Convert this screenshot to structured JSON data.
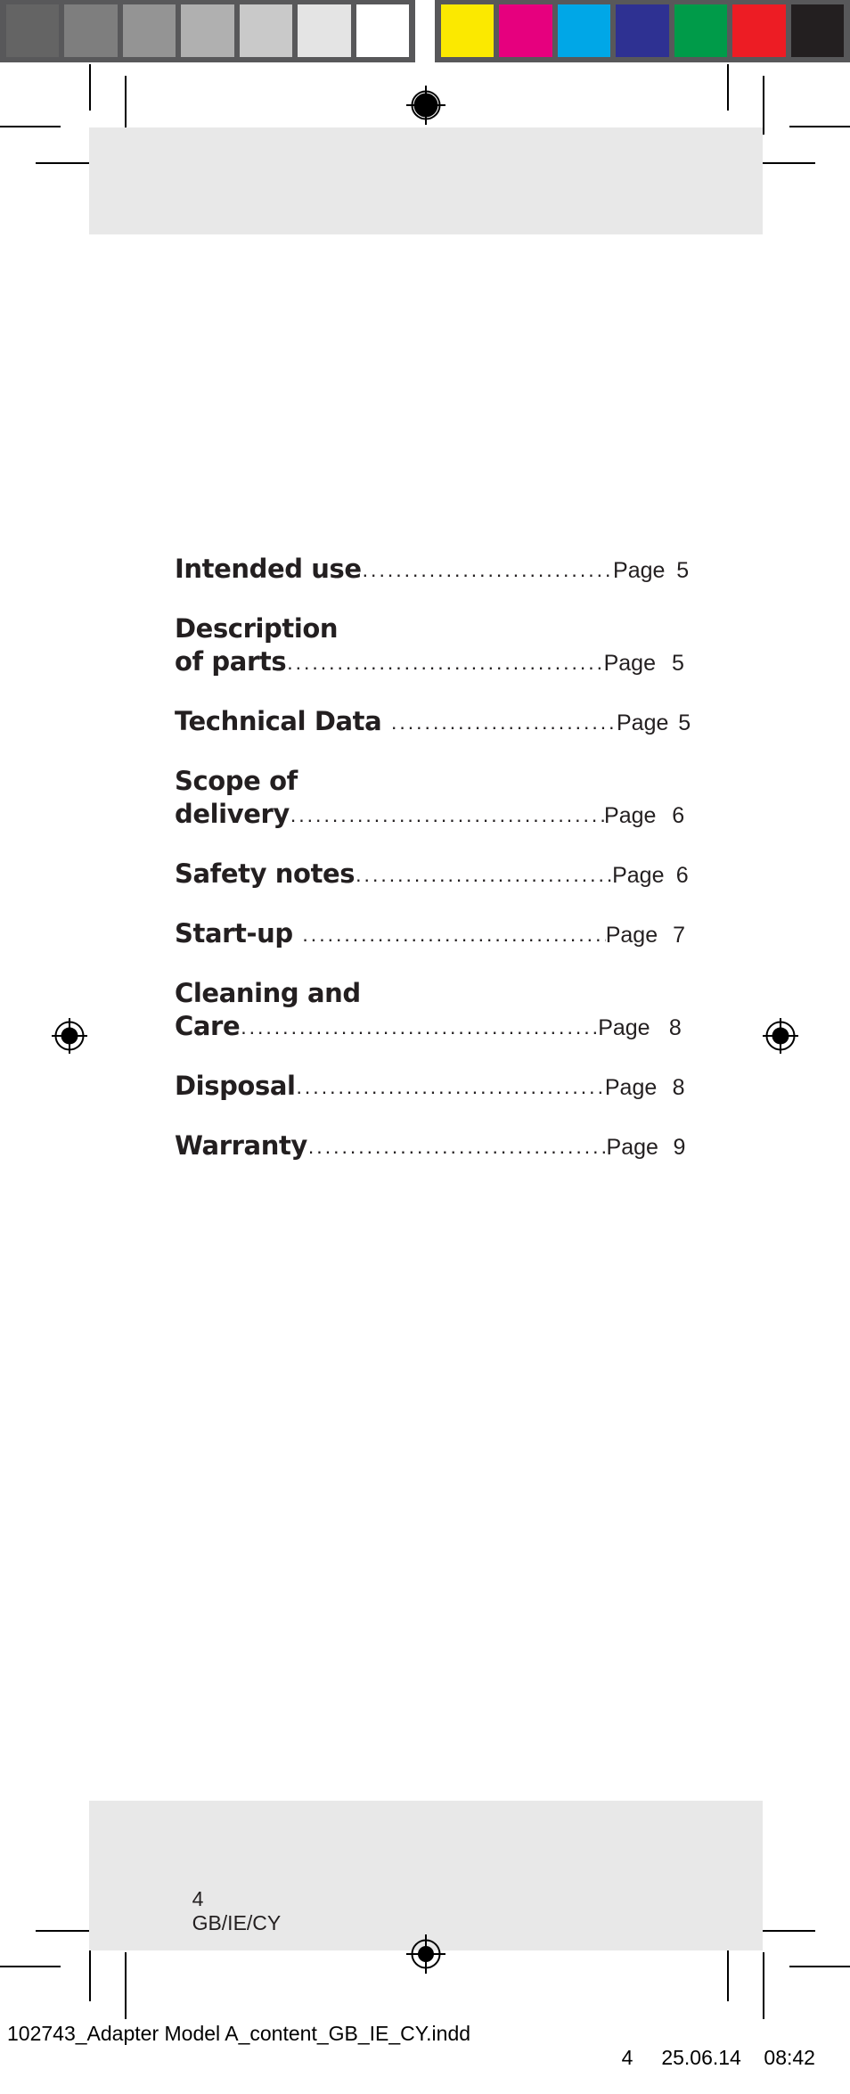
{
  "calibration": {
    "grayscale_swatches": [
      "#646464",
      "#7e7e7e",
      "#949494",
      "#b0b0b0",
      "#c9c9c9",
      "#e4e4e4",
      "#ffffff"
    ],
    "color_swatches": [
      "#fbe900",
      "#e6007e",
      "#00a7e7",
      "#2e3192",
      "#009b49",
      "#ed1c24",
      "#231f20"
    ],
    "bar_background": "#58585a"
  },
  "panel": {
    "background": "#e8e8e8"
  },
  "toc": {
    "entries": [
      {
        "title": "Intended use",
        "page_label": "Page",
        "page_number": "5"
      },
      {
        "title": "Description\nof parts",
        "page_label": "Page",
        "page_number": "5"
      },
      {
        "title": "Technical Data ",
        "page_label": "Page",
        "page_number": "5"
      },
      {
        "title": "Scope of\ndelivery",
        "page_label": "Page",
        "page_number": "6"
      },
      {
        "title": "Safety notes",
        "page_label": "Page",
        "page_number": "6"
      },
      {
        "title": "Start-up ",
        "page_label": "Page",
        "page_number": "7"
      },
      {
        "title": "Cleaning and\nCare",
        "page_label": "Page",
        "page_number": "8"
      },
      {
        "title": "Disposal",
        "page_label": "Page",
        "page_number": "8"
      },
      {
        "title": "Warranty",
        "page_label": "Page",
        "page_number": "9"
      }
    ]
  },
  "footer": {
    "page_number": "4",
    "region_code": "GB/IE/CY"
  },
  "job_slug": {
    "filename": "102743_Adapter Model A_content_GB_IE_CY.indd",
    "page": "4",
    "date": "25.06.14",
    "time": "08:42"
  }
}
